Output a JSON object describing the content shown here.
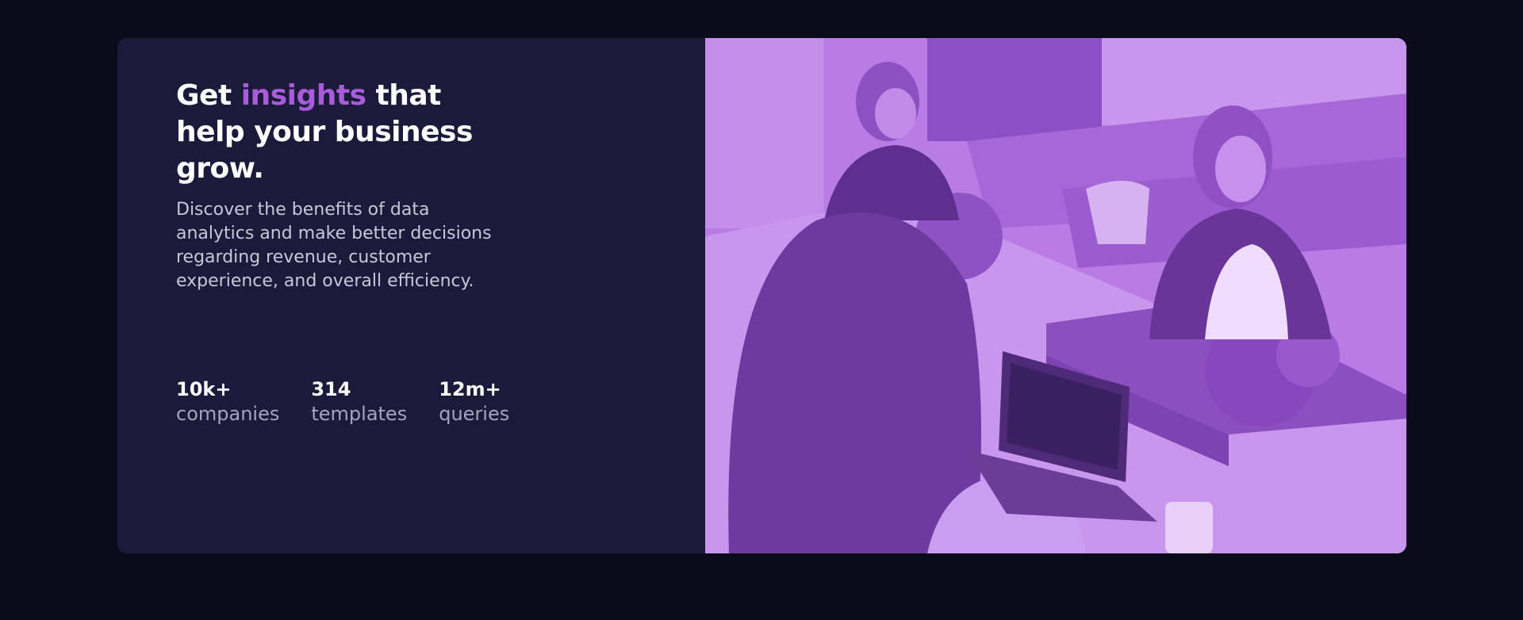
{
  "hero": {
    "headline_before": "Get ",
    "headline_accent": "insights",
    "headline_after": " that help your business grow.",
    "description": "Discover the benefits of data analytics and make better decisions regarding revenue, customer experience, and overall efficiency.",
    "stats": [
      {
        "value": "10k+",
        "label": "companies"
      },
      {
        "value": "314",
        "label": "templates"
      },
      {
        "value": "12m+",
        "label": "queries"
      }
    ]
  },
  "colors": {
    "page_background": "#090b1a",
    "card_background": "#1c1a3b",
    "accent": "#a85cd9",
    "photo_tint": "#b97be6"
  },
  "image": {
    "icon": "office-team-photo"
  }
}
